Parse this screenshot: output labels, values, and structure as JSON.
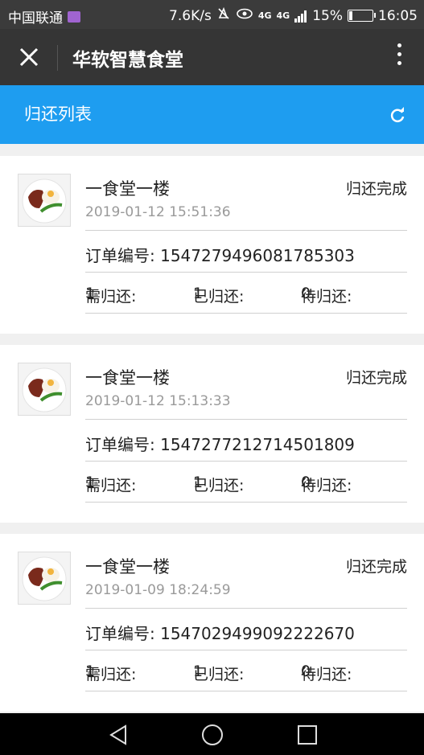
{
  "statusbar": {
    "carrier": "中国联通",
    "net_speed": "7.6K/s",
    "net1": "4G",
    "net2": "4G",
    "battery": "15%",
    "battery_level": 0.15,
    "time": "16:05"
  },
  "titlebar": {
    "close_icon": "close-icon",
    "title": "华软智慧食堂",
    "more_icon": "more-vertical-icon"
  },
  "header": {
    "title": "归还列表",
    "refresh_icon": "refresh-icon"
  },
  "records": [
    {
      "name": "一食堂一楼",
      "time": "2019-01-12 15:51:36",
      "status": "归还完成",
      "order_label": "订单编号:",
      "order_no": "1547279496081785303",
      "need_label": "需归还:",
      "need": "1",
      "returned_label": "已归还:",
      "returned": "1",
      "pending_label": "待归还:",
      "pending": "0"
    },
    {
      "name": "一食堂一楼",
      "time": "2019-01-12 15:13:33",
      "status": "归还完成",
      "order_label": "订单编号:",
      "order_no": "1547277212714501809",
      "need_label": "需归还:",
      "need": "1",
      "returned_label": "已归还:",
      "returned": "1",
      "pending_label": "待归还:",
      "pending": "0"
    },
    {
      "name": "一食堂一楼",
      "time": "2019-01-09 18:24:59",
      "status": "归还完成",
      "order_label": "订单编号:",
      "order_no": "1547029499092222670",
      "need_label": "需归还:",
      "need": "1",
      "returned_label": "已归还:",
      "returned": "1",
      "pending_label": "待归还:",
      "pending": "0"
    }
  ],
  "navbar": {
    "back_icon": "back-triangle-icon",
    "home_icon": "home-circle-icon",
    "recents_icon": "recents-square-icon"
  },
  "colors": {
    "header_blue": "#1e9df0",
    "titlebar": "#353535",
    "statusbar": "#3b3b3b"
  }
}
